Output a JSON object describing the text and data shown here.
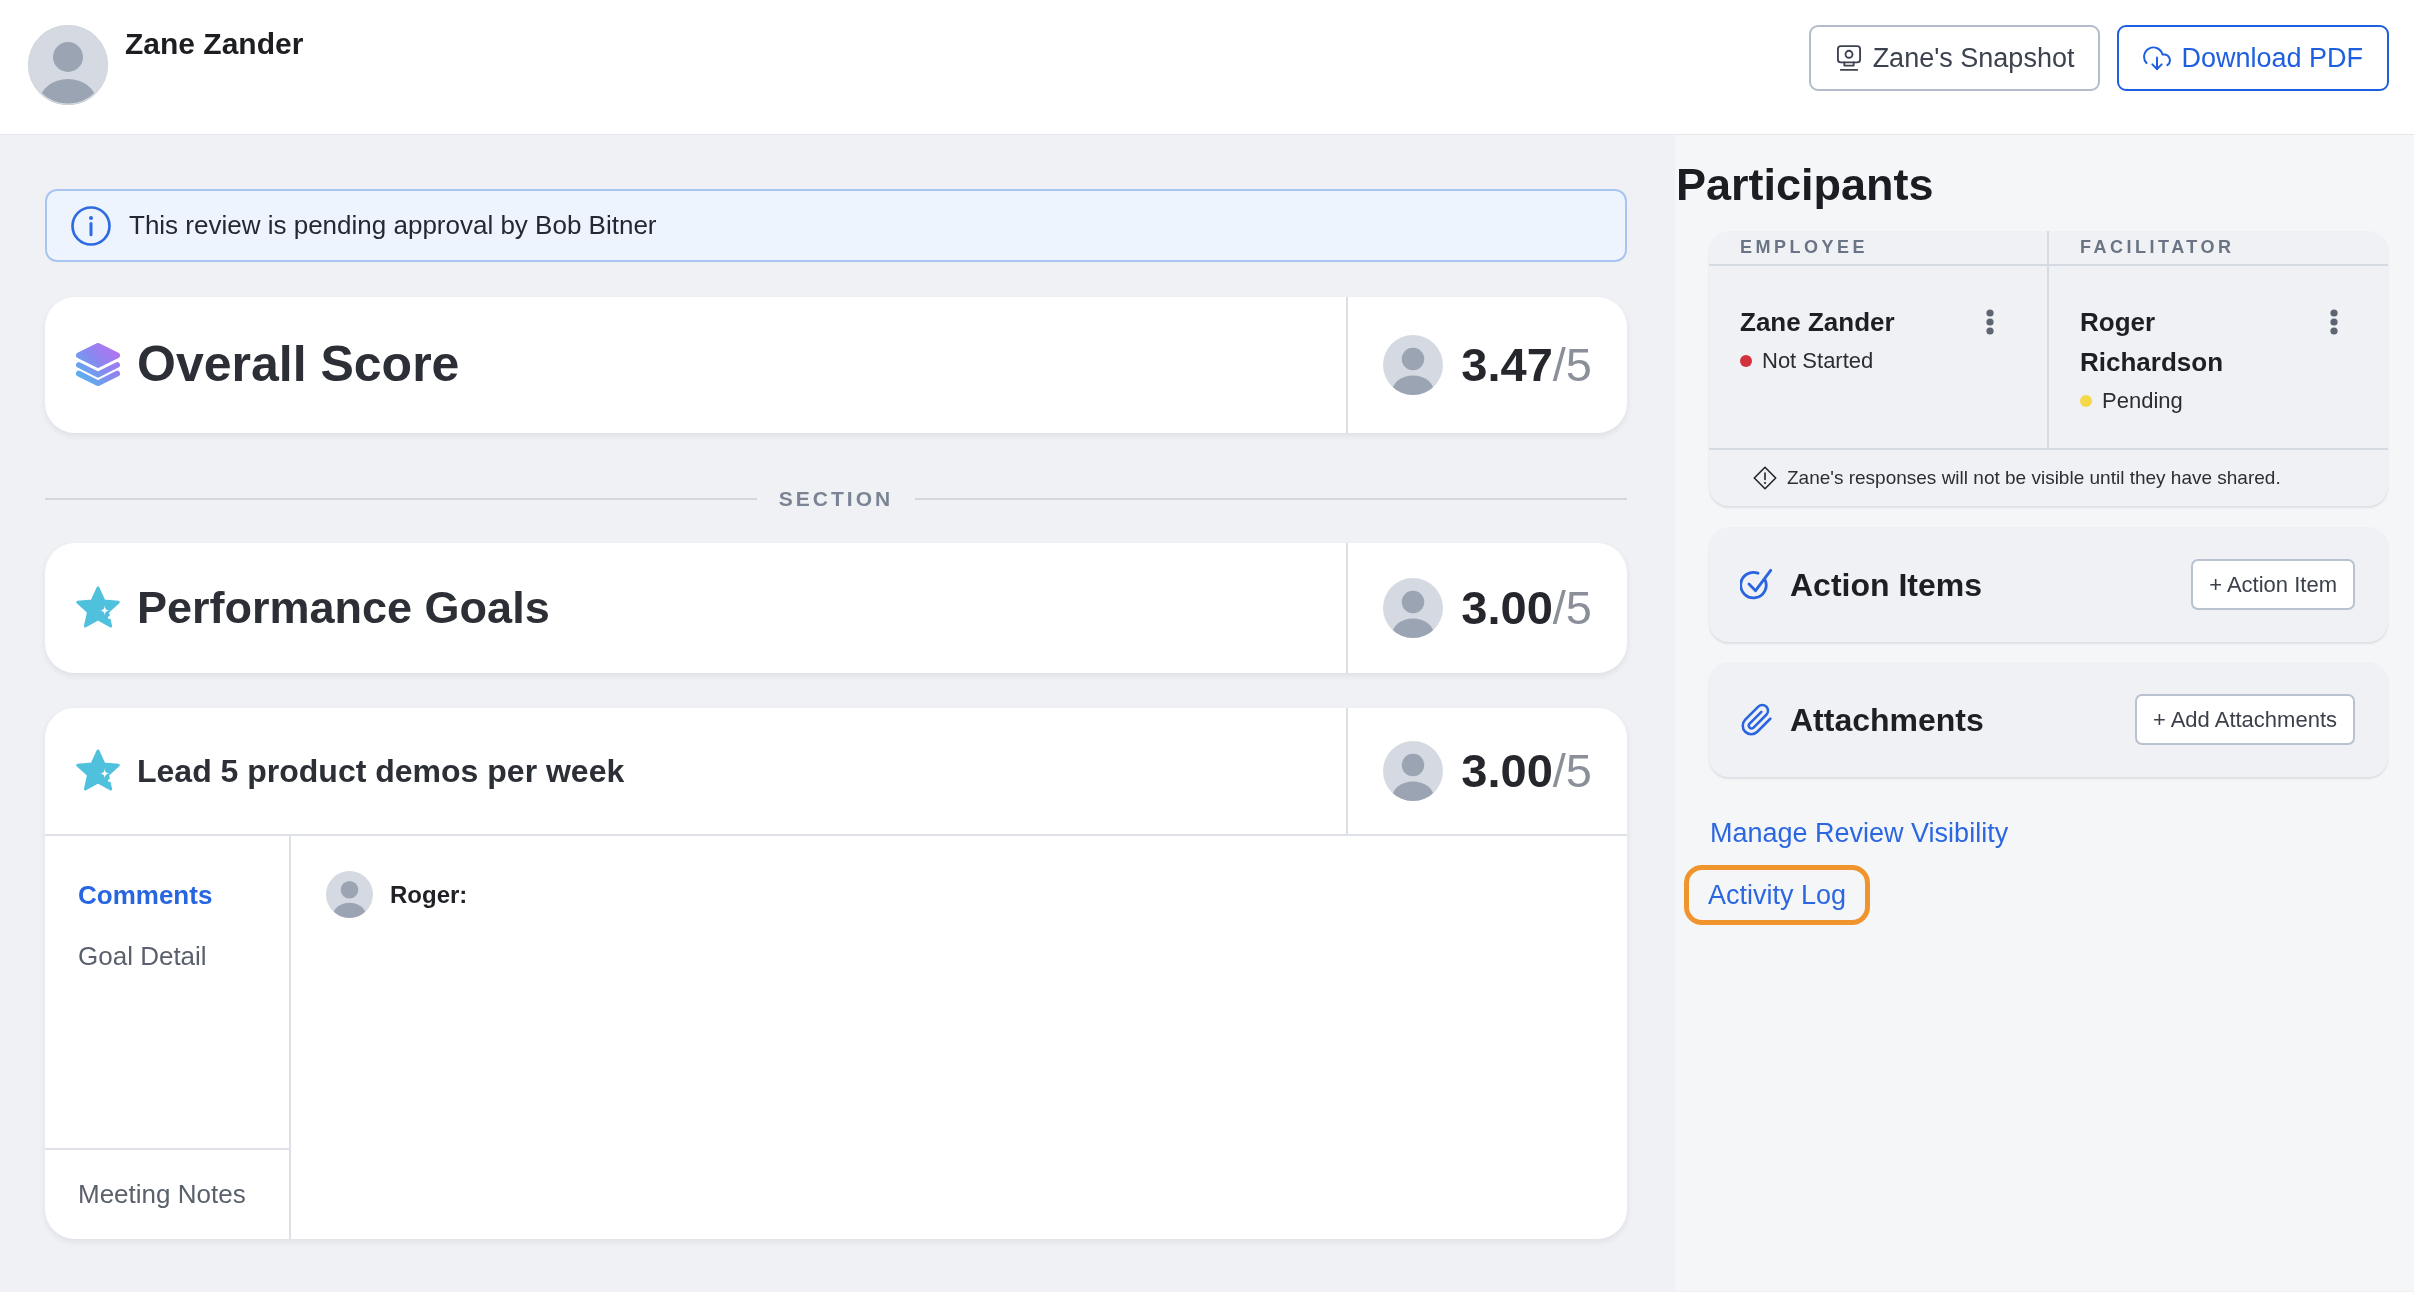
{
  "header": {
    "name": "Zane Zander",
    "buttons": [
      {
        "kind": "snapshot",
        "label": "Zane's Snapshot"
      },
      {
        "kind": "download",
        "label": "Download PDF"
      }
    ]
  },
  "alert": {
    "text": "This review is pending approval by Bob Bitner"
  },
  "overall": {
    "title": "Overall Score",
    "score": "**3.47**/5"
  },
  "section": {
    "label": "SECTION",
    "title": "Performance Goals",
    "score": "**3.00**/5"
  },
  "goal": {
    "title": "Lead 5 product demos per week",
    "score": "**3.00**/5",
    "tabs": [
      {
        "label": "Comments",
        "selected": true
      },
      {
        "label": "Goal Detail",
        "selected": false
      }
    ],
    "notes_tab": {
      "label": "Meeting Notes",
      "selected": false
    },
    "comments": [
      {
        "author": "Roger:"
      }
    ]
  },
  "participants": {
    "title": "Participants",
    "columns": [
      {
        "heading": "EMPLOYEE",
        "name": "Zane Zander",
        "status": "Not Started",
        "color": "#d2323c"
      },
      {
        "heading": "FACILITATOR",
        "name": "Roger Richardson",
        "status": "Pending",
        "color": "#f5d847"
      }
    ],
    "notice": "Zane's responses will not be visible until they have shared."
  },
  "panels": [
    {
      "kind": "action_items",
      "title": "Action Items",
      "button": "+ Action Item"
    },
    {
      "kind": "attachments",
      "title": "Attachments",
      "button": "+ Add Attachments"
    }
  ],
  "links": [
    {
      "label": "Manage Review Visibility",
      "highlighted": false
    },
    {
      "label": "Activity Log",
      "highlighted": true
    }
  ]
}
